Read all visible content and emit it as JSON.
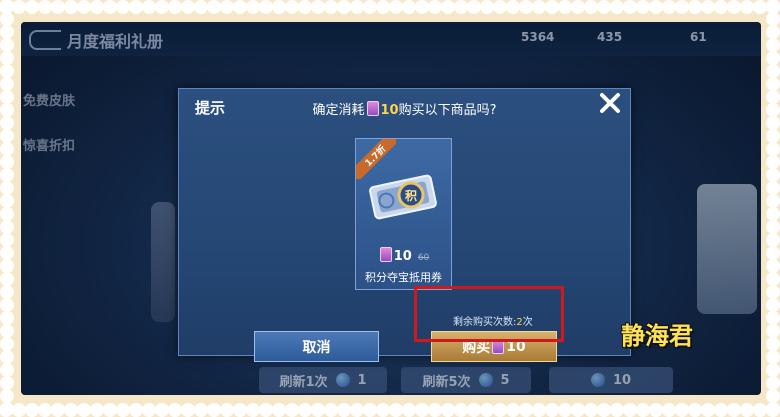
{
  "background": {
    "header": {
      "title": "月度福利礼册",
      "resources": [
        "5364",
        "435",
        "61"
      ]
    },
    "sidebar": [
      "免费皮肤",
      "惊喜折扣"
    ],
    "refresh_buttons": [
      {
        "label": "刷新1次",
        "cost": "1"
      },
      {
        "label": "刷新5次",
        "cost": "5"
      },
      {
        "label": "",
        "cost": "10"
      }
    ]
  },
  "dialog": {
    "title": "提示",
    "question_prefix": "确定消耗",
    "question_amount": "10",
    "question_suffix": "购买以下商品吗?",
    "item": {
      "ribbon": "1.7折",
      "price": "10",
      "original_price": "60",
      "name": "积分夺宝抵用券",
      "icon_glyph": "积"
    },
    "remaining_label": "剩余购买次数:",
    "remaining_count": "2",
    "remaining_suffix": "次",
    "cancel_label": "取消",
    "buy_label": "购买",
    "buy_amount": "10"
  },
  "watermark": "静海君",
  "colors": {
    "highlight": "#ffd447",
    "annotation_box": "#d01a1a",
    "accent_gold": "#d8b16c"
  }
}
